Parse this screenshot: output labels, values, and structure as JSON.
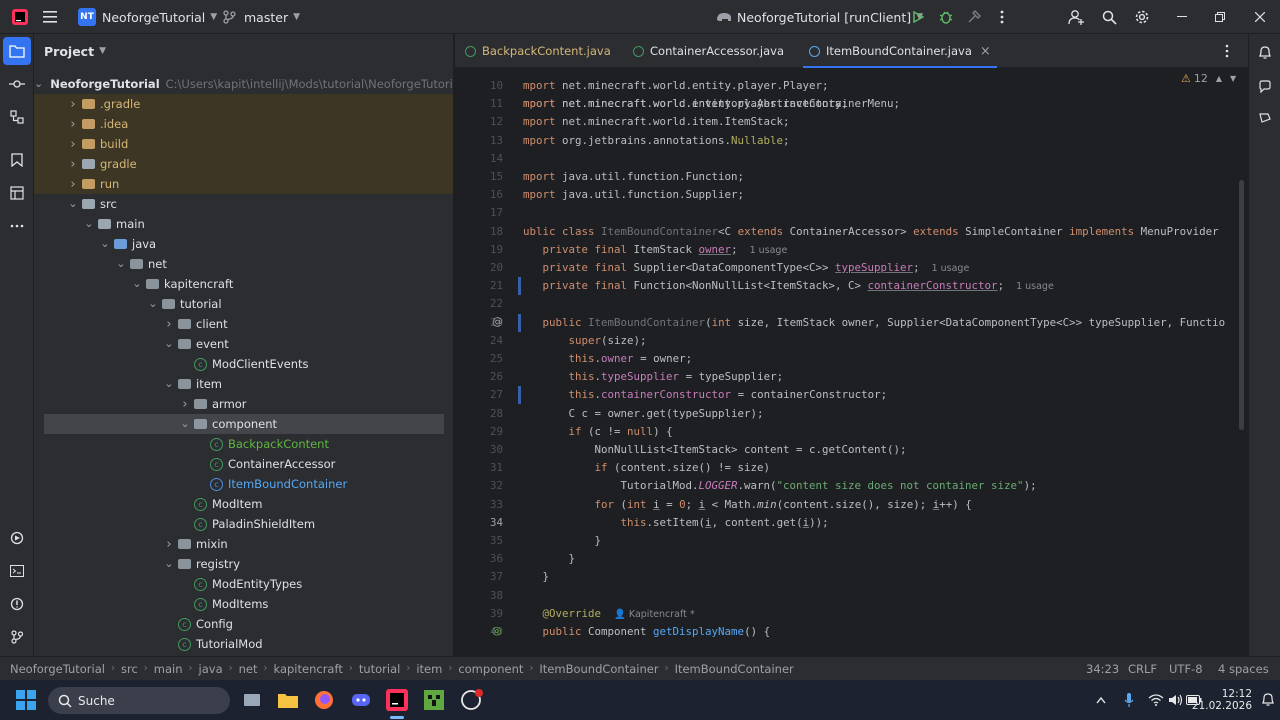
{
  "titlebar": {
    "project_badge": "NT",
    "project_name": "NeoforgeTutorial",
    "branch": "master",
    "run_config": "NeoforgeTutorial [runClient]"
  },
  "project_panel": {
    "title": "Project",
    "tree": [
      {
        "label": "NeoforgeTutorial",
        "hint": "C:\\Users\\kapit\\intellij\\Mods\\tutorial\\NeoforgeTutorial",
        "depth": 1,
        "icon": "module",
        "open": true
      },
      {
        "label": ".gradle",
        "depth": 2,
        "icon": "orange",
        "open": false,
        "excluded": true
      },
      {
        "label": ".idea",
        "depth": 2,
        "icon": "orange",
        "open": false,
        "excluded": true
      },
      {
        "label": "build",
        "depth": 2,
        "icon": "orange",
        "open": false,
        "excluded": true
      },
      {
        "label": "gradle",
        "depth": 2,
        "icon": "plain",
        "open": false,
        "excluded": true
      },
      {
        "label": "run",
        "depth": 2,
        "icon": "orange",
        "open": false,
        "excluded": true
      },
      {
        "label": "src",
        "depth": 2,
        "icon": "plain",
        "open": true
      },
      {
        "label": "main",
        "depth": 3,
        "icon": "module",
        "open": true
      },
      {
        "label": "java",
        "depth": 4,
        "icon": "blue",
        "open": true
      },
      {
        "label": "net",
        "depth": 5,
        "icon": "pkg",
        "open": true
      },
      {
        "label": "kapitencraft",
        "depth": 6,
        "icon": "pkg",
        "open": true
      },
      {
        "label": "tutorial",
        "depth": 7,
        "icon": "pkg",
        "open": true
      },
      {
        "label": "client",
        "depth": 8,
        "icon": "pkg",
        "open": false
      },
      {
        "label": "event",
        "depth": 8,
        "icon": "pkg",
        "open": true
      },
      {
        "label": "ModClientEvents",
        "depth": 9,
        "icon": "class"
      },
      {
        "label": "item",
        "depth": 8,
        "icon": "pkg",
        "open": true
      },
      {
        "label": "armor",
        "depth": 9,
        "icon": "pkg",
        "open": false
      },
      {
        "label": "component",
        "depth": 9,
        "icon": "pkg",
        "open": true,
        "selected": true
      },
      {
        "label": "BackpackContent",
        "depth": 10,
        "icon": "class",
        "color": "green"
      },
      {
        "label": "ContainerAccessor",
        "depth": 10,
        "icon": "class"
      },
      {
        "label": "ItemBoundContainer",
        "depth": 10,
        "icon": "class-blue",
        "color": "blue"
      },
      {
        "label": "ModItem",
        "depth": 9,
        "icon": "class"
      },
      {
        "label": "PaladinShieldItem",
        "depth": 9,
        "icon": "class"
      },
      {
        "label": "mixin",
        "depth": 8,
        "icon": "pkg",
        "open": false
      },
      {
        "label": "registry",
        "depth": 8,
        "icon": "pkg",
        "open": true
      },
      {
        "label": "ModEntityTypes",
        "depth": 9,
        "icon": "class"
      },
      {
        "label": "ModItems",
        "depth": 9,
        "icon": "class"
      },
      {
        "label": "Config",
        "depth": 8,
        "icon": "class"
      },
      {
        "label": "TutorialMod",
        "depth": 8,
        "icon": "class"
      }
    ]
  },
  "tabs": [
    {
      "label": "BackpackContent.java",
      "color": "orange"
    },
    {
      "label": "ContainerAccessor.java"
    },
    {
      "label": "ItemBoundContainer.java",
      "active": true,
      "close": "×"
    }
  ],
  "editor": {
    "warnings_count": "12",
    "lines": [
      {
        "n": "10",
        "html": "<span class='kw'>mport</span> net.minecraft.world.entity.player.Player;"
      },
      {
        "n": "11",
        "html": "<span class='kw'>mport</span> net.minecraft.world.inventory.AbstractContainerMenu;"
      },
      {
        "n": "12",
        "html": "<span class='kw'>mport</span> net.minecraft.world.item.ItemStack;"
      },
      {
        "n": "13",
        "html": "<span class='kw'>mport</span> org.jetbrains.annotations.<span class='ann'>Nullable</span>;"
      },
      {
        "n": "14",
        "html": ""
      },
      {
        "n": "15",
        "html": "<span class='kw'>mport</span> java.util.function.Function;"
      },
      {
        "n": "16",
        "html": "<span class='kw'>mport</span> java.util.function.Supplier;"
      },
      {
        "n": "17",
        "html": ""
      },
      {
        "n": "18",
        "html": "<span class='kw'>ublic class</span> <span class='gray'>ItemBoundContainer</span>&lt;C <span class='kw'>extends</span> ContainerAccessor&gt; <span class='kw'>extends</span> SimpleContainer <span class='kw'>implements</span> MenuProvider"
      },
      {
        "n": "19",
        "html": "   <span class='kw'>private final</span> ItemStack <span class='fld uline'>owner</span>;<span class='hint'>1 usage</span>"
      },
      {
        "n": "20",
        "html": "   <span class='kw'>private final</span> Supplier&lt;DataComponentType&lt;C&gt;&gt; <span class='fld uline'>typeSupplier</span>;<span class='hint'>1 usage</span>"
      },
      {
        "n": "21",
        "html": "   <span class='kw'>private final</span> Function&lt;NonNullList&lt;ItemStack&gt;, C&gt; <span class='fld uline'>containerConstructor</span>;<span class='hint'>1 usage</span>"
      },
      {
        "n": "22",
        "html": ""
      },
      {
        "n": "23",
        "html": "   <span class='kw'>public</span> <span class='gray'>ItemBoundContainer</span>(<span class='kw'>int</span> size, ItemStack owner, Supplier&lt;DataComponentType&lt;C&gt;&gt; typeSupplier, Functio"
      },
      {
        "n": "24",
        "html": "       <span class='kw'>super</span>(size);"
      },
      {
        "n": "25",
        "html": "       <span class='kw'>this</span>.<span class='fld'>owner</span> = owner;"
      },
      {
        "n": "26",
        "html": "       <span class='kw'>this</span>.<span class='fld'>typeSupplier</span> = typeSupplier;"
      },
      {
        "n": "27",
        "html": "       <span class='kw'>this</span>.<span class='fld'>containerConstructor</span> = containerConstructor;"
      },
      {
        "n": "28",
        "html": "       C c = owner.get(typeSupplier);"
      },
      {
        "n": "29",
        "html": "       <span class='kw'>if</span> (c != <span class='kw'>null</span>) {"
      },
      {
        "n": "30",
        "html": "           NonNullList&lt;ItemStack&gt; content = c.getContent();"
      },
      {
        "n": "31",
        "html": "           <span class='kw'>if</span> (content.size() != size)"
      },
      {
        "n": "32",
        "html": "               TutorialMod.<span class='fld' style='font-style:italic'>LOGGER</span>.warn(<span class='str'>\"content size does not container size\"</span>);"
      },
      {
        "n": "33",
        "html": "           <span class='kw'>for</span> (<span class='kw'>int</span> <span class='uline'>i</span> = <span class='kw'>0</span>; <span class='uline'>i</span> &lt; Math.<span style='font-style:italic'>min</span>(content.size(), size); <span class='uline'>i</span>++) {"
      },
      {
        "n": "34",
        "html": "               <span class='kw'>this</span>.setItem(<span class='uline'>i</span>, content.get(<span class='uline'>i</span>));"
      },
      {
        "n": "35",
        "html": "           }"
      },
      {
        "n": "36",
        "html": "       }"
      },
      {
        "n": "37",
        "html": "   }"
      },
      {
        "n": "38",
        "html": ""
      },
      {
        "n": "39",
        "html": "   <span class='ann'>@Override</span>  <span class='hint' style='margin-left:0'>&#128100; Kapitencraft *</span>"
      },
      {
        "n": "40",
        "html": "   <span class='kw'>public</span> Component <span style='color:#56a8f5'>getDisplayName</span>() {"
      }
    ]
  },
  "statusbar": {
    "breadcrumbs": [
      "NeoforgeTutorial",
      "src",
      "main",
      "java",
      "net",
      "kapitencraft",
      "tutorial",
      "item",
      "component",
      "ItemBoundContainer",
      "ItemBoundContainer"
    ],
    "position": "34:23",
    "line_sep": "CRLF",
    "encoding": "UTF-8",
    "indent": "4 spaces"
  },
  "taskbar": {
    "search_placeholder": "Suche",
    "time": "12:12",
    "date": "21.02.2026"
  }
}
